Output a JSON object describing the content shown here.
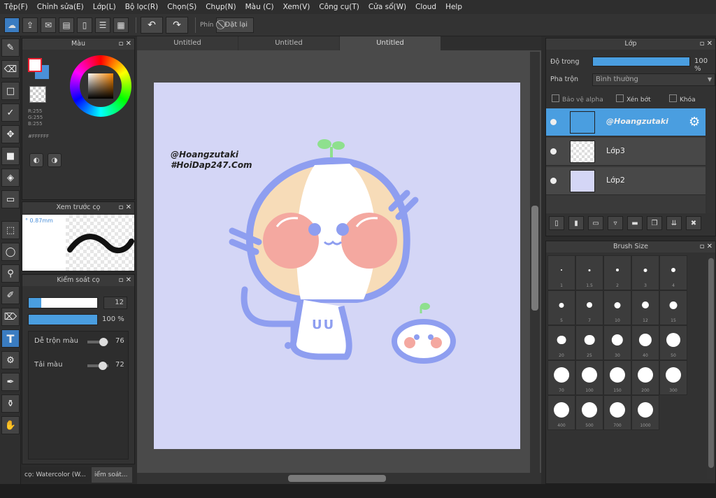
{
  "menu": [
    "Tệp(F)",
    "Chỉnh sửa(E)",
    "Lớp(L)",
    "Bộ lọc(R)",
    "Chọn(S)",
    "Chụp(N)",
    "Màu (C)",
    "Xem(V)",
    "Công cụ(T)",
    "Cửa sổ(W)",
    "Cloud",
    "Help"
  ],
  "toolbar": {
    "pin_label": "Phín",
    "reset_label": "Đặt lại"
  },
  "color_panel": {
    "title": "Màu",
    "r": "R:255",
    "g": "G:255",
    "b": "B:255",
    "hex": "#FFFFFF"
  },
  "preview_panel": {
    "title": "Xem trước cọ",
    "size": "0.87mm"
  },
  "control_panel": {
    "title": "Kiểm soát cọ",
    "size_value": "12",
    "opacity_value": "100 %",
    "mix_label": "Dễ trộn màu",
    "mix_value": "76",
    "load_label": "Tải màu",
    "load_value": "72",
    "size_fraction": 0.18,
    "opacity_fraction": 1.0,
    "mix_fraction": 0.76,
    "load_fraction": 0.72
  },
  "left_tabs": [
    "cọ: Watercolor (W...",
    "iểm soát..."
  ],
  "doc_tabs": [
    "Untitled",
    "Untitled",
    "Untitled"
  ],
  "canvas": {
    "watermark_line1": "@Hoangzutaki",
    "watermark_line2": "#HoiDap247.Com",
    "mascot_text": "UU",
    "background": "#d4d6f6"
  },
  "layer_panel": {
    "title": "Lớp",
    "opacity_label": "Độ trong",
    "opacity_value": "100 %",
    "blend_label": "Pha trộn",
    "blend_value": "Bình thường",
    "check_protect": "Bảo vệ alpha",
    "check_clip": "Xén bớt",
    "check_lock": "Khóa",
    "layers": [
      "@Hoangzutaki",
      "Lớp3",
      "Lớp2"
    ]
  },
  "brush_panel": {
    "title": "Brush Size",
    "sizes": [
      "1",
      "1.5",
      "2",
      "3",
      "4",
      "5",
      "7",
      "10",
      "12",
      "15",
      "20",
      "25",
      "30",
      "40",
      "50",
      "70",
      "100",
      "150",
      "200",
      "300",
      "400",
      "500",
      "700",
      "1000"
    ]
  },
  "colors": {
    "accent": "#4a9ee0",
    "canvas_bg": "#d4d6f6",
    "mascot_outline": "#8e9ef0",
    "mascot_cheek": "#f4a8a0",
    "mascot_cream": "#f7dcb8",
    "sprout": "#8ee08e"
  }
}
